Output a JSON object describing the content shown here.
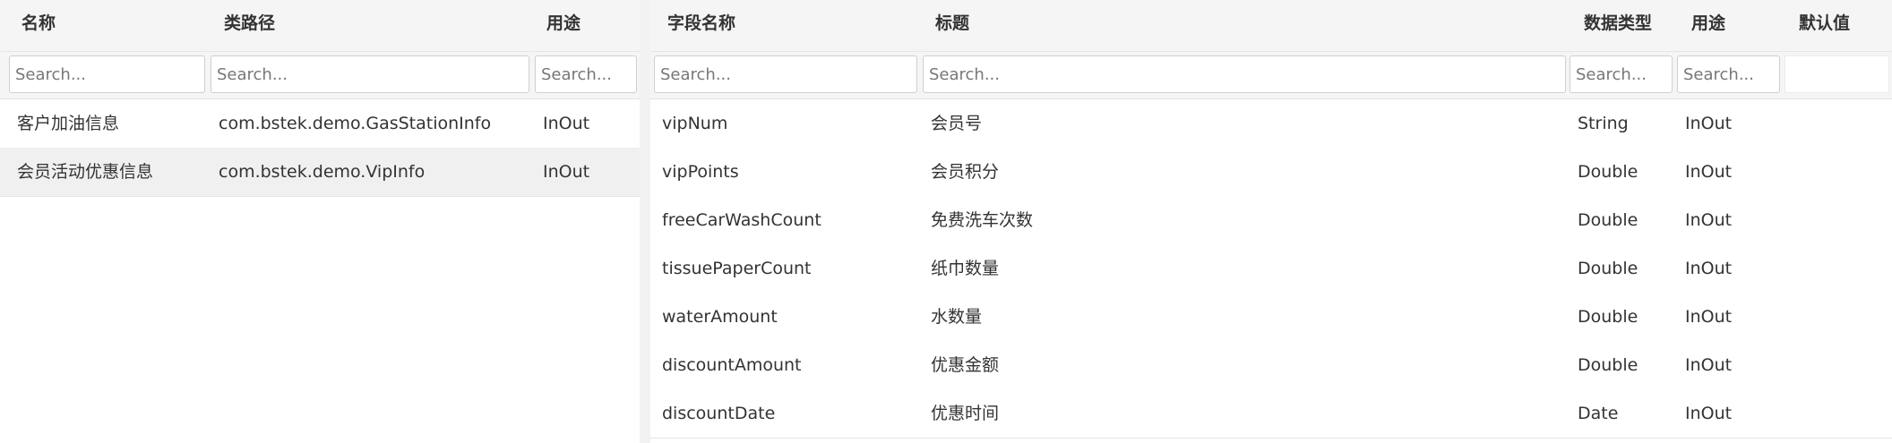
{
  "left_table": {
    "columns": [
      "名称",
      "类路径",
      "用途"
    ],
    "filter_placeholders": [
      "Search...",
      "Search...",
      "Search..."
    ],
    "rows": [
      {
        "name": "客户加油信息",
        "class_path": "com.bstek.demo.GasStationInfo",
        "usage": "InOut"
      },
      {
        "name": "会员活动优惠信息",
        "class_path": "com.bstek.demo.VipInfo",
        "usage": "InOut"
      }
    ]
  },
  "right_table": {
    "columns": [
      "字段名称",
      "标题",
      "数据类型",
      "用途",
      "默认值"
    ],
    "filter_placeholders": [
      "Search...",
      "Search...",
      "Search...",
      "Search..."
    ],
    "rows": [
      {
        "field": "vipNum",
        "title": "会员号",
        "type": "String",
        "usage": "InOut"
      },
      {
        "field": "vipPoints",
        "title": "会员积分",
        "type": "Double",
        "usage": "InOut"
      },
      {
        "field": "freeCarWashCount",
        "title": "免费洗车次数",
        "type": "Double",
        "usage": "InOut"
      },
      {
        "field": "tissuePaperCount",
        "title": "纸巾数量",
        "type": "Double",
        "usage": "InOut"
      },
      {
        "field": "waterAmount",
        "title": "水数量",
        "type": "Double",
        "usage": "InOut"
      },
      {
        "field": "discountAmount",
        "title": "优惠金额",
        "type": "Double",
        "usage": "InOut"
      },
      {
        "field": "discountDate",
        "title": "优惠时间",
        "type": "Date",
        "usage": "InOut"
      }
    ]
  }
}
